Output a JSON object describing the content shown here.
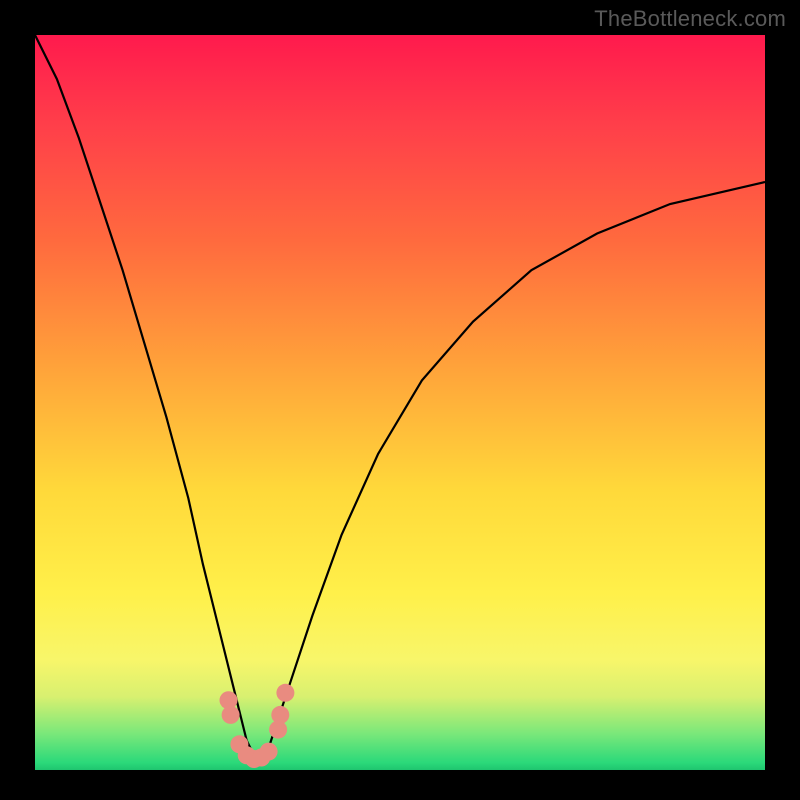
{
  "attribution": "TheBottleneck.com",
  "chart_data": {
    "type": "line",
    "title": "",
    "xlabel": "",
    "ylabel": "",
    "xlim": [
      0,
      100
    ],
    "ylim": [
      0,
      100
    ],
    "series": [
      {
        "name": "bottleneck-curve",
        "x": [
          0,
          3,
          6,
          9,
          12,
          15,
          18,
          21,
          23,
          25,
          27,
          28,
          29,
          30,
          31,
          32,
          33,
          35,
          38,
          42,
          47,
          53,
          60,
          68,
          77,
          87,
          100
        ],
        "y": [
          100,
          94,
          86,
          77,
          68,
          58,
          48,
          37,
          28,
          20,
          12,
          8,
          4,
          2,
          2,
          3,
          6,
          12,
          21,
          32,
          43,
          53,
          61,
          68,
          73,
          77,
          80
        ]
      }
    ],
    "markers": {
      "name": "marker-dots",
      "color": "#e98b80",
      "points": [
        {
          "x": 26.5,
          "y": 9.5
        },
        {
          "x": 26.8,
          "y": 7.5
        },
        {
          "x": 28.0,
          "y": 3.5
        },
        {
          "x": 29.0,
          "y": 2.0
        },
        {
          "x": 30.0,
          "y": 1.5
        },
        {
          "x": 31.0,
          "y": 1.7
        },
        {
          "x": 32.0,
          "y": 2.5
        },
        {
          "x": 33.3,
          "y": 5.5
        },
        {
          "x": 33.6,
          "y": 7.5
        },
        {
          "x": 34.3,
          "y": 10.5
        }
      ]
    },
    "background_gradient": {
      "top": "#ff1a4d",
      "mid1": "#ffa23a",
      "mid2": "#fff04a",
      "bottom": "#1fc56f"
    }
  }
}
